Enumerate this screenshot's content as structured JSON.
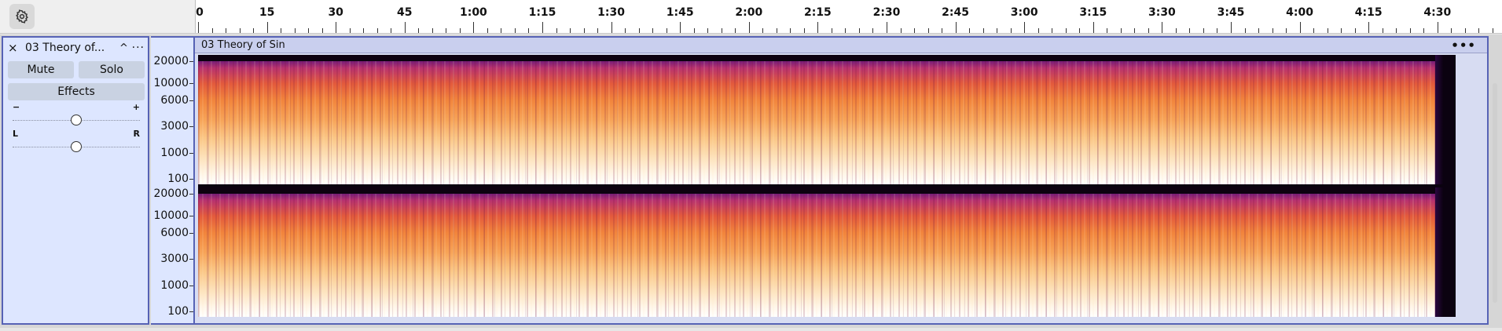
{
  "timeline": {
    "settings_icon": "gear-icon",
    "ticks": [
      "0",
      "15",
      "30",
      "45",
      "1:00",
      "1:15",
      "1:30",
      "1:45",
      "2:00",
      "2:15",
      "2:30",
      "2:45",
      "3:00",
      "3:15",
      "3:30",
      "3:45",
      "4:00",
      "4:15",
      "4:30"
    ]
  },
  "track": {
    "close_icon": "×",
    "name": "03 Theory of...",
    "collapse_icon": "^",
    "menu_icon": "···",
    "mute_label": "Mute",
    "solo_label": "Solo",
    "effects_label": "Effects",
    "gain": {
      "min_label": "−",
      "max_label": "+",
      "value": 0.5
    },
    "pan": {
      "left_label": "L",
      "right_label": "R",
      "value": 0.5
    }
  },
  "freq_ruler": {
    "labels": [
      "20000",
      "10000",
      "6000",
      "3000",
      "1000",
      "100"
    ]
  },
  "clip": {
    "title": "03 Theory of Sin",
    "menu_icon": "•••"
  },
  "colors": {
    "accent": "#5662b5",
    "track_bg": "#dde6ff"
  }
}
